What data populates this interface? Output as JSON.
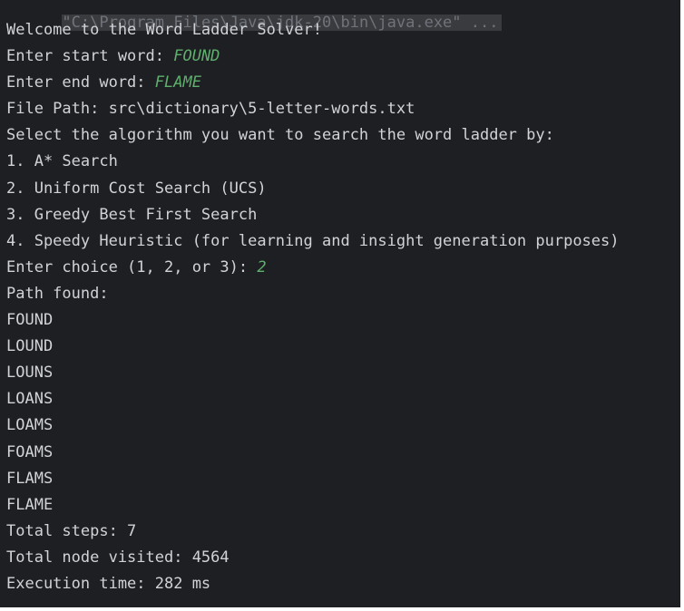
{
  "console": {
    "command_line": "\"C:\\Program Files\\Java\\jdk-20\\bin\\java.exe\" ...",
    "welcome": "Welcome to the Word Ladder Solver!",
    "start_prompt": "Enter start word: ",
    "start_input": "FOUND",
    "end_prompt": "Enter end word: ",
    "end_input": "FLAME",
    "file_path": "File Path: src\\dictionary\\5-letter-words.txt",
    "select_prompt": "Select the algorithm you want to search the word ladder by:",
    "options": [
      "1. A* Search",
      "2. Uniform Cost Search (UCS)",
      "3. Greedy Best First Search",
      "4. Speedy Heuristic (for learning and insight generation purposes)"
    ],
    "choice_prompt": "Enter choice (1, 2, or 3): ",
    "choice_input": "2",
    "path_found": "Path found:",
    "path": [
      "FOUND",
      "LOUND",
      "LOUNS",
      "LOANS",
      "LOAMS",
      "FOAMS",
      "FLAMS",
      "FLAME"
    ],
    "total_steps": "Total steps: 7",
    "total_nodes": "Total node visited: 4564",
    "execution_time": "Execution time: 282 ms"
  },
  "colors": {
    "background": "#1e1f22",
    "text": "#d0d3d8",
    "input_text": "#5faf6e",
    "command_text": "#6f737a"
  }
}
